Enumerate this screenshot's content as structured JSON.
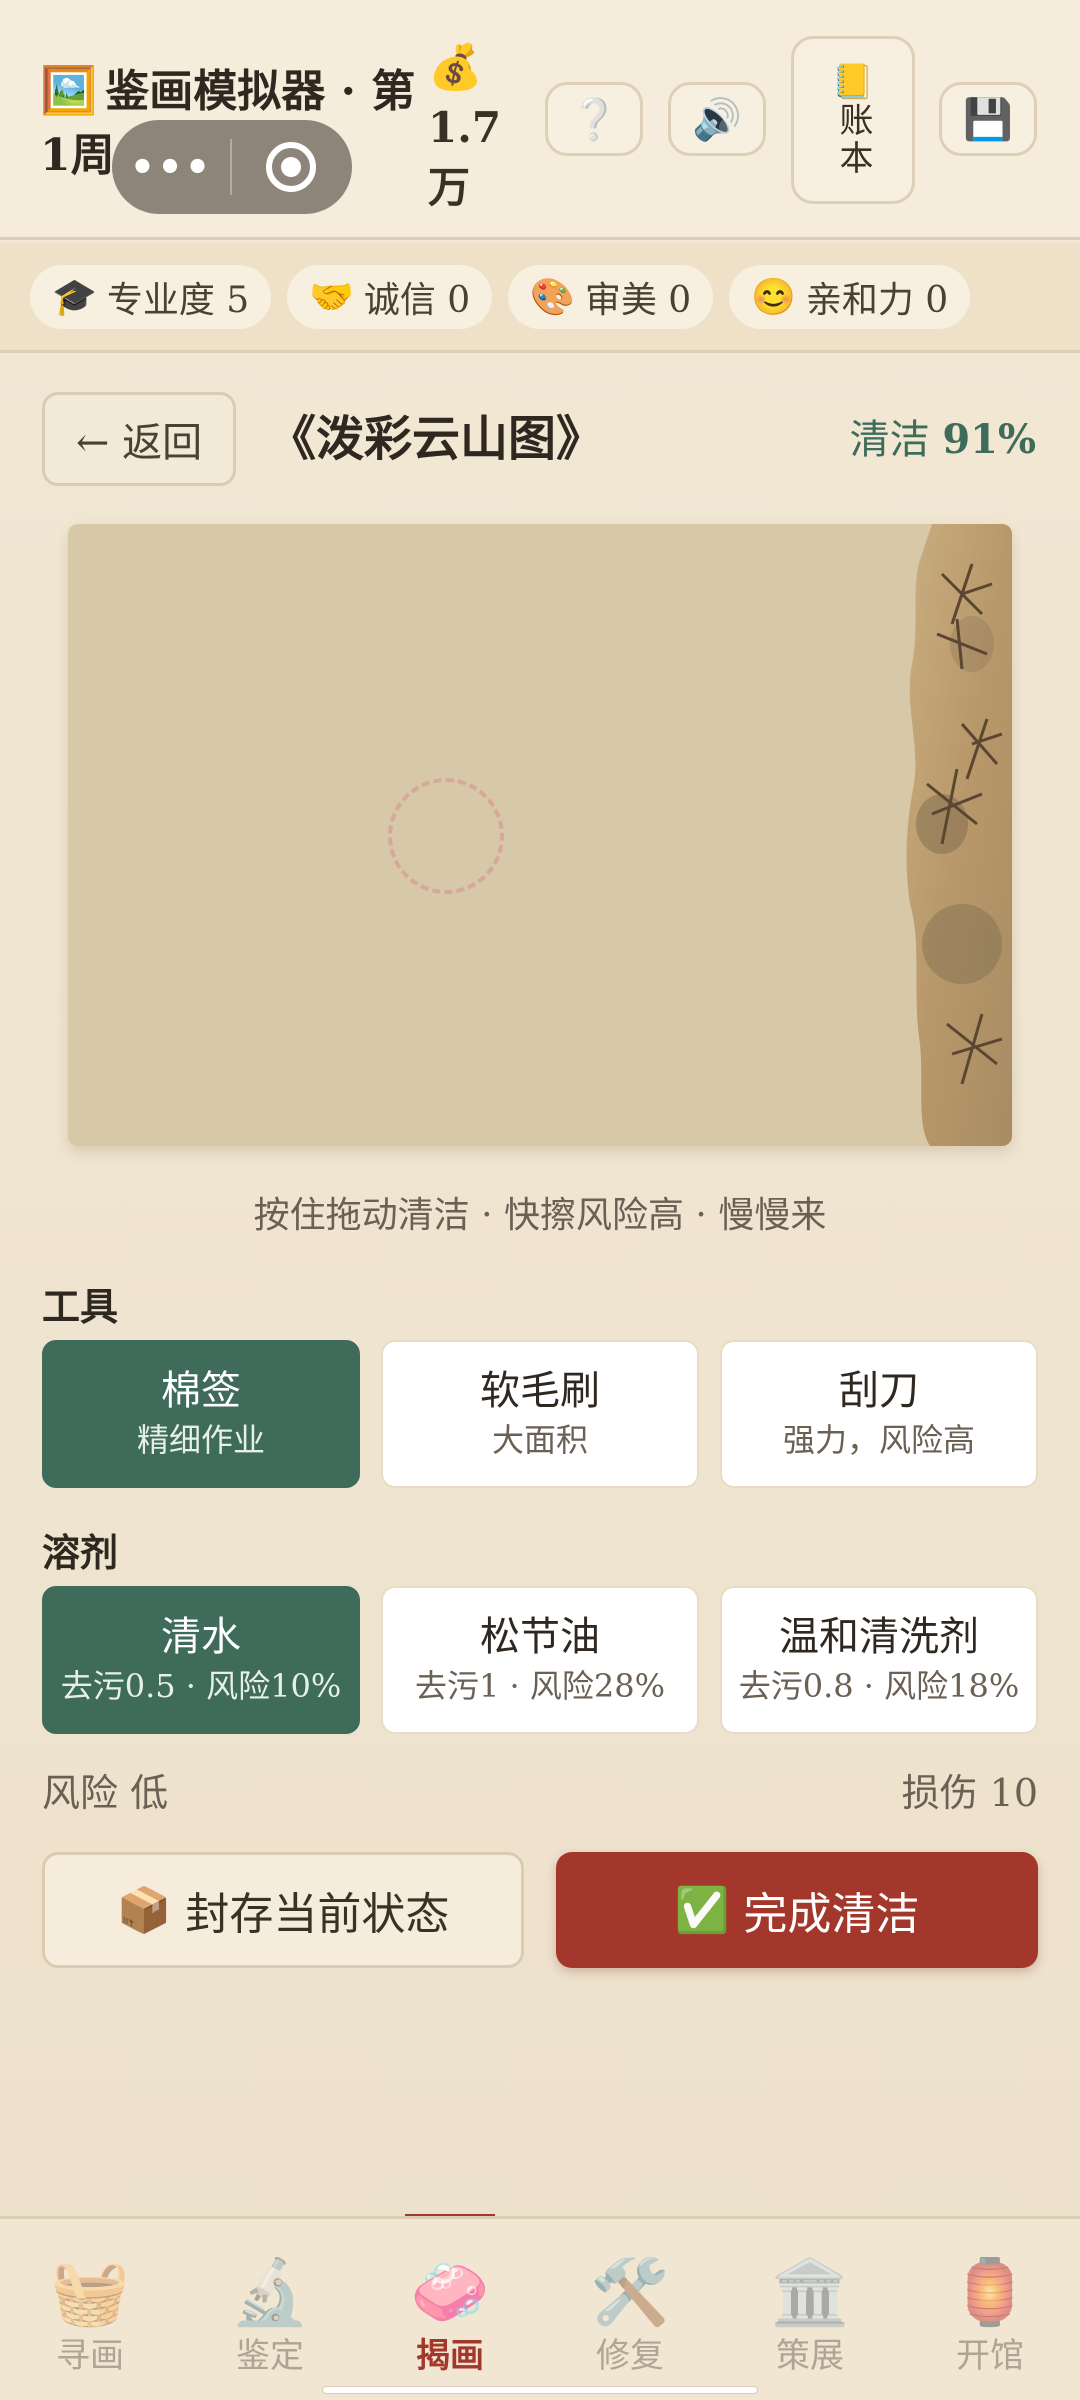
{
  "header": {
    "title_icon": "🖼️",
    "title": "鉴画模拟器 · 第1周",
    "coins_icon": "💰",
    "coins": "1.7万",
    "help_label": "❔",
    "sound_label": "🔊",
    "ledger_icon": "📒",
    "ledger_label": "账本",
    "save_label": "💾"
  },
  "stats": [
    {
      "icon": "🎓",
      "label": "专业度 5"
    },
    {
      "icon": "🤝",
      "label": "诚信 0"
    },
    {
      "icon": "🎨",
      "label": "审美 0"
    },
    {
      "icon": "😊",
      "label": "亲和力 0"
    }
  ],
  "subheader": {
    "back_label": "← 返回",
    "painting_title": "《泼彩云山图》",
    "clean_label": "清洁",
    "clean_value": "91%"
  },
  "hint": "按住拖动清洁 · 快擦风险高 · 慢慢来",
  "tools": {
    "label": "工具",
    "items": [
      {
        "name": "棉签",
        "desc": "精细作业",
        "selected": true
      },
      {
        "name": "软毛刷",
        "desc": "大面积",
        "selected": false
      },
      {
        "name": "刮刀",
        "desc": "强力，风险高",
        "selected": false
      }
    ]
  },
  "solvents": {
    "label": "溶剂",
    "items": [
      {
        "name": "清水",
        "desc": "去污0.5 · 风险10%",
        "selected": true
      },
      {
        "name": "松节油",
        "desc": "去污1 · 风险28%",
        "selected": false
      },
      {
        "name": "温和清洗剂",
        "desc": "去污0.8 · 风险18%",
        "selected": false
      }
    ]
  },
  "status": {
    "risk": "风险 低",
    "damage": "损伤 10"
  },
  "actions": {
    "archive_icon": "📦",
    "archive_label": "封存当前状态",
    "finish_icon": "✅",
    "finish_label": "完成清洁"
  },
  "nav": [
    {
      "icon": "🧺",
      "label": "寻画",
      "active": false
    },
    {
      "icon": "🔬",
      "label": "鉴定",
      "active": false
    },
    {
      "icon": "🧼",
      "label": "揭画",
      "active": true
    },
    {
      "icon": "🛠️",
      "label": "修复",
      "active": false
    },
    {
      "icon": "🏛️",
      "label": "策展",
      "active": false
    },
    {
      "icon": "🏮",
      "label": "开馆",
      "active": false
    }
  ],
  "colors": {
    "accent_green": "#3f6b5a",
    "accent_red": "#a4372b",
    "background": "#f1e6d1"
  }
}
